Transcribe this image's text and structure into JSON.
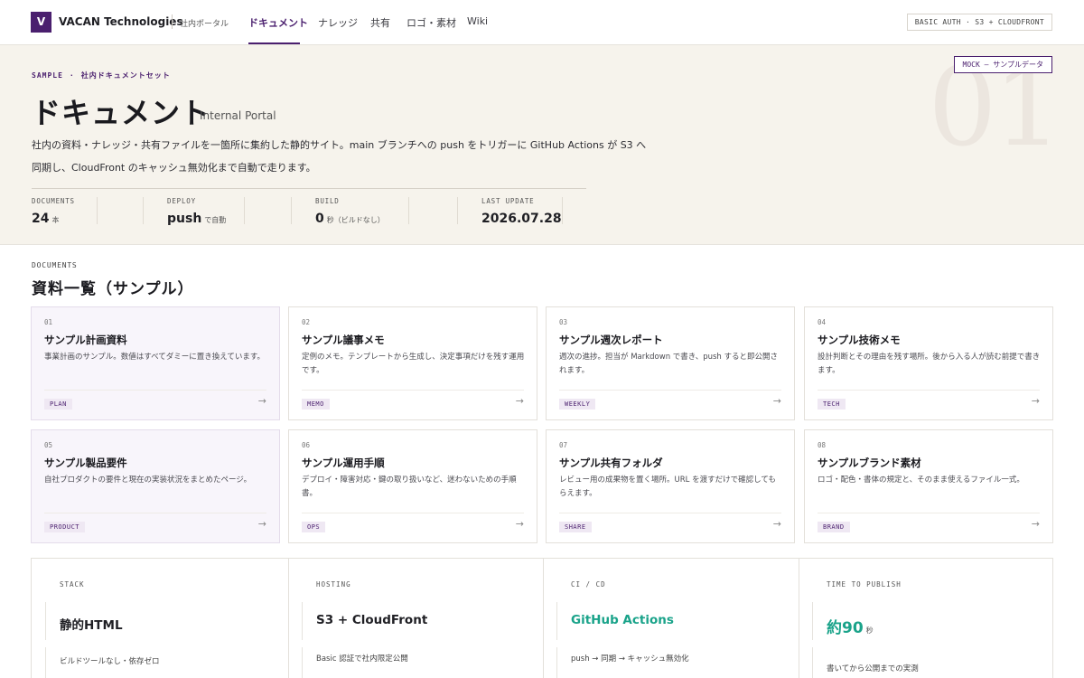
{
  "header": {
    "logo_letter": "V",
    "brand": "VACAN Technologies",
    "brand_sub": "社内ポータル",
    "nav": [
      "ドキュメント",
      "ナレッジ",
      "共有",
      "ロゴ・素材",
      "Wiki"
    ],
    "active_nav": "ドキュメント",
    "auth_badge": "BASIC AUTH · S3 + CLOUDFRONT"
  },
  "hero": {
    "eyebrow_a": "SAMPLE",
    "eyebrow_b": "社内ドキュメントセット",
    "title": "ドキュメント",
    "subtitle": "Internal Portal",
    "description": "社内の資料・ナレッジ・共有ファイルを一箇所に集約した静的サイト。main ブランチへの push をトリガーに GitHub Actions が S3 へ同期し、CloudFront のキャッシュ無効化まで自動で走ります。",
    "mock_badge": "MOCK — サンプルデータ",
    "big_number": "01",
    "stats": [
      {
        "label": "DOCUMENTS",
        "value": "24",
        "unit": "本"
      },
      {
        "label": "DEPLOY",
        "value": "push",
        "unit": "で自動"
      },
      {
        "label": "BUILD",
        "value": "0",
        "unit": "秒（ビルドなし）"
      },
      {
        "label": "LAST UPDATE",
        "value": "2026.07.28",
        "unit": ""
      }
    ]
  },
  "documents": {
    "eyebrow": "DOCUMENTS",
    "title": "資料一覧（サンプル）",
    "cards": [
      {
        "num": "01",
        "title": "サンプル計画資料",
        "desc": "事業計画のサンプル。数値はすべてダミーに置き換えています。",
        "tag": "PLAN",
        "arrow": "→"
      },
      {
        "num": "02",
        "title": "サンプル議事メモ",
        "desc": "定例のメモ。テンプレートから生成し、決定事項だけを残す運用です。",
        "tag": "MEMO",
        "arrow": "→"
      },
      {
        "num": "03",
        "title": "サンプル週次レポート",
        "desc": "週次の進捗。担当が Markdown で書き、push すると即公開されます。",
        "tag": "WEEKLY",
        "arrow": "→"
      },
      {
        "num": "04",
        "title": "サンプル技術メモ",
        "desc": "設計判断とその理由を残す場所。後から入る人が読む前提で書きます。",
        "tag": "TECH",
        "arrow": "→"
      },
      {
        "num": "05",
        "title": "サンプル製品要件",
        "desc": "自社プロダクトの要件と現在の実装状況をまとめたページ。",
        "tag": "PRODUCT",
        "arrow": "→"
      },
      {
        "num": "06",
        "title": "サンプル運用手順",
        "desc": "デプロイ・障害対応・鍵の取り扱いなど、迷わないための手順書。",
        "tag": "OPS",
        "arrow": "→"
      },
      {
        "num": "07",
        "title": "サンプル共有フォルダ",
        "desc": "レビュー用の成果物を置く場所。URL を渡すだけで確認してもらえます。",
        "tag": "SHARE",
        "arrow": "→"
      },
      {
        "num": "08",
        "title": "サンプルブランド素材",
        "desc": "ロゴ・配色・書体の規定と、そのまま使えるファイル一式。",
        "tag": "BRAND",
        "arrow": "→"
      }
    ]
  },
  "panels": [
    {
      "label": "STACK",
      "value": "静的HTML",
      "unit": "",
      "note": "ビルドツールなし・依存ゼロ"
    },
    {
      "label": "HOSTING",
      "value": "S3 + CloudFront",
      "unit": "",
      "note": "Basic 認証で社内限定公開"
    },
    {
      "label": "CI / CD",
      "value": "GitHub Actions",
      "unit": "",
      "note": "push → 同期 → キャッシュ無効化"
    },
    {
      "label": "TIME TO PUBLISH",
      "value": "約90",
      "unit": "秒",
      "note": "書いてから公開までの実測"
    }
  ],
  "colors": {
    "brand": "#4a1f6e",
    "accent": "#1aa38a",
    "hero_bg": "#f6f3ec"
  }
}
